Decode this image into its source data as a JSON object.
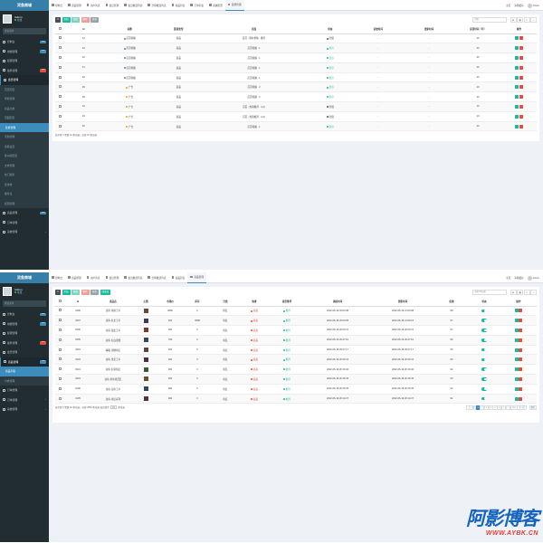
{
  "sidebar": {
    "logo": "双鱼商城",
    "user_name": "Admin",
    "user_status": "在线",
    "search_placeholder": "搜索菜单",
    "items": [
      {
        "label": "控制台",
        "badge": "new",
        "badge_color": "#3c8dbc"
      },
      {
        "label": "常规管理",
        "badge": "new",
        "badge_color": "#3c8dbc"
      },
      {
        "label": "权限管理",
        "badge": "",
        "badge_color": ""
      },
      {
        "label": "插件管理",
        "badge": "new",
        "badge_color": "#e74c3c"
      },
      {
        "label": "会员管理",
        "badge": "",
        "badge_color": ""
      },
      {
        "label": "商品管理",
        "badge": "new",
        "badge_color": "#3c8dbc"
      },
      {
        "label": "订单管理",
        "badge": "",
        "badge_color": ""
      }
    ]
  },
  "panel1": {
    "topnav_tabs": [
      "控制台",
      "商品管理",
      "用户列表",
      "会员管理",
      "会员推送列表",
      "分销推送列表",
      "商品列表",
      "订单列表",
      "系统配置",
      "装修管理"
    ],
    "topnav_right": [
      "主页",
      "清除缓存",
      "Admin"
    ],
    "submenu_parent": "装修管理",
    "submenu": [
      "首页配置",
      "导航管理",
      "商品分类",
      "页面配置",
      "装修管理",
      "专题管理",
      "客服设置",
      "移动端配置",
      "文章管理",
      "热门搜索",
      "优惠券",
      "推荐位",
      "权限管理"
    ],
    "submenu_active": 4,
    "bottom_menu": "系统管理",
    "toolbar": {
      "add": "添加",
      "edit": "编辑",
      "del": "删除",
      "more": "更多"
    },
    "search_placeholder": "搜索",
    "columns": [
      "",
      "Id",
      "标题",
      "链接类型",
      "页面",
      "状态",
      "初始时间",
      "更新时间",
      "运营时间（年）",
      "操作"
    ],
    "rows": [
      {
        "id": "44",
        "title": "首页轮播",
        "dot": "#3c8dbc",
        "type": "商品",
        "page": "首页 - 限时抢购 · 推荐",
        "status": "隐藏",
        "status_color": "#555",
        "t1": "-",
        "t2": "-",
        "years": "20"
      },
      {
        "id": "43",
        "title": "首页轮播",
        "dot": "#3c8dbc",
        "type": "商品",
        "page": "首页轮播 · 1",
        "status": "显示",
        "status_color": "#18bc9c",
        "t1": "-",
        "t2": "-",
        "years": "20"
      },
      {
        "id": "42",
        "title": "首页轮播",
        "dot": "#3c8dbc",
        "type": "商品",
        "page": "首页轮播 · 1",
        "status": "显示",
        "status_color": "#18bc9c",
        "t1": "-",
        "t2": "-",
        "years": "20"
      },
      {
        "id": "41",
        "title": "首页轮播",
        "dot": "#3c8dbc",
        "type": "商品",
        "page": "首页轮播 · 1",
        "status": "显示",
        "status_color": "#18bc9c",
        "t1": "-",
        "t2": "-",
        "years": "20"
      },
      {
        "id": "40",
        "title": "首页轮播",
        "dot": "#3c8dbc",
        "type": "商品",
        "page": "首页轮播 · 1",
        "status": "显示",
        "status_color": "#18bc9c",
        "t1": "-",
        "t2": "-",
        "years": "20"
      },
      {
        "id": "39",
        "title": "广告",
        "dot": "#f39c12",
        "type": "商品",
        "page": "首页轮播 · 2",
        "status": "显示",
        "status_color": "#18bc9c",
        "t1": "-",
        "t2": "-",
        "years": "20"
      },
      {
        "id": "38",
        "title": "广告",
        "dot": "#f39c12",
        "type": "商品",
        "page": "首页轮播 · 2",
        "status": "显示",
        "status_color": "#18bc9c",
        "t1": "-",
        "t2": "-",
        "years": "20"
      },
      {
        "id": "34",
        "title": "广告",
        "dot": "#f39c12",
        "type": "商品",
        "page": "首页 - 热销推荐 · 1(1)",
        "status": "隐藏",
        "status_color": "#555",
        "t1": "-",
        "t2": "-",
        "years": "10"
      },
      {
        "id": "33",
        "title": "广告",
        "dot": "#f39c12",
        "type": "商品",
        "page": "首页 - 热销推荐 · 1(1)",
        "status": "隐藏",
        "status_color": "#555",
        "t1": "-",
        "t2": "-",
        "years": "10"
      },
      {
        "id": "32",
        "title": "广告",
        "dot": "#f39c12",
        "type": "商品",
        "page": "首页轮播 · 1",
        "status": "显示",
        "status_color": "#18bc9c",
        "t1": "-",
        "t2": "-",
        "years": "20"
      }
    ],
    "footer": "显示第 1 到第 10 条记录，总共 10 条记录"
  },
  "panel2": {
    "topnav_tabs": [
      "控制台",
      "商品管理",
      "用户列表",
      "会员管理",
      "会员推送列表",
      "分销推送列表",
      "商品列表",
      "商品管理"
    ],
    "topnav_right": [
      "主页",
      "清除缓存",
      "Admin"
    ],
    "submenu_parent": "商品管理",
    "submenu": [
      "商品列表",
      "分类管理"
    ],
    "submenu_active": 0,
    "bottom_items": [
      "订单管理",
      "系统管理"
    ],
    "toolbar": {
      "add": "添加",
      "edit": "编辑",
      "del": "删除",
      "more": "更多",
      "recycle": "回收站"
    },
    "search_placeholder": "搜索ID/标题",
    "columns": [
      "",
      "Id",
      "商品名",
      "主图",
      "市场价",
      "库存",
      "分类",
      "热推",
      "是否推荐",
      "添加时间",
      "更新时间",
      "权重",
      "状态",
      "操作"
    ],
    "rows": [
      {
        "id": "3338",
        "name": "双鱼·鱼尾王平",
        "price": "3900",
        "stock": "0",
        "cat": "鱼缸",
        "hot": "商品",
        "rec": "推荐",
        "added": "2022-06-19 03:03:08",
        "updated": "2022-06-19 21:00:08",
        "weight": "98"
      },
      {
        "id": "3337",
        "name": "双鱼·红龙王平",
        "price": "390",
        "stock": "3098",
        "cat": "鱼缸",
        "hot": "商品",
        "rec": "推荐",
        "added": "2022-06-19 20:03:05",
        "updated": "2022-06-19 21:00:16",
        "weight": "97"
      },
      {
        "id": "3336",
        "name": "双鱼·银龙王平",
        "price": "390",
        "stock": "0",
        "cat": "鱼缸",
        "hot": "商品",
        "rec": "推荐",
        "added": "2022-06-19 20:20:21",
        "updated": "2022-06-19 20:20:21",
        "weight": "97"
      },
      {
        "id": "3335",
        "name": "双鱼·红白锦鲤",
        "price": "790",
        "stock": "0",
        "cat": "鱼缸",
        "hot": "商品",
        "rec": "推荐",
        "added": "2022-06-19 20:27:10",
        "updated": "2022-06-19 20:27:10",
        "weight": "96"
      },
      {
        "id": "3334",
        "name": "睡眠·锦鲤鱼缸",
        "price": "390",
        "stock": "0",
        "cat": "鱼缸",
        "hot": "商品",
        "rec": "推荐",
        "added": "2022-06-19 20:27:17",
        "updated": "2022-06-19 20:27:17",
        "weight": "96"
      },
      {
        "id": "3333",
        "name": "双鱼·金龙王平",
        "price": "390",
        "stock": "0",
        "cat": "鱼缸",
        "hot": "商品",
        "rec": "推荐",
        "added": "2022-06-19 20:20:41",
        "updated": "2022-06-19 20:20:41",
        "weight": "95"
      },
      {
        "id": "3331",
        "name": "双鱼·红尾鱼缸",
        "price": "390",
        "stock": "0",
        "cat": "鱼缸",
        "hot": "商品",
        "rec": "推荐",
        "added": "2022-06-19 20:16:40",
        "updated": "2022-06-19 20:16:40",
        "weight": "94"
      },
      {
        "id": "3323",
        "name": "双鱼·金鱼观赏缸",
        "price": "390",
        "stock": "0",
        "cat": "鱼缸",
        "hot": "商品",
        "rec": "推荐",
        "added": "2022-06-19 20:16:45",
        "updated": "2022-06-19 20:16:45",
        "weight": "93"
      },
      {
        "id": "3106",
        "name": "双鱼·龙鱼王平",
        "price": "390",
        "stock": "0",
        "cat": "鱼缸",
        "hot": "商品",
        "rec": "推荐",
        "added": "2022-06-19 20:16:45",
        "updated": "2022-06-19 20:16:45",
        "weight": "92"
      },
      {
        "id": "3105",
        "name": "双鱼·鱼缸系列",
        "price": "390",
        "stock": "0",
        "cat": "鱼缸",
        "hot": "商品",
        "rec": "推荐",
        "added": "2022-06-19 20:14:37",
        "updated": "2022-06-19 20:14:37",
        "weight": "91"
      }
    ],
    "footer_prefix": "显示第 1 到第 10 条记录，总共 2536 条记录 每页显示",
    "footer_perpage": "10",
    "footer_suffix": "条记录",
    "pager": [
      "上一页",
      "1",
      "2",
      "3",
      "4",
      "5",
      "6",
      "7",
      "...",
      "254",
      "下一页"
    ],
    "pager_active": 1,
    "goto": "跳转"
  },
  "watermark": {
    "main": "阿影博客",
    "sub": "WWW.AYBK.CN"
  }
}
